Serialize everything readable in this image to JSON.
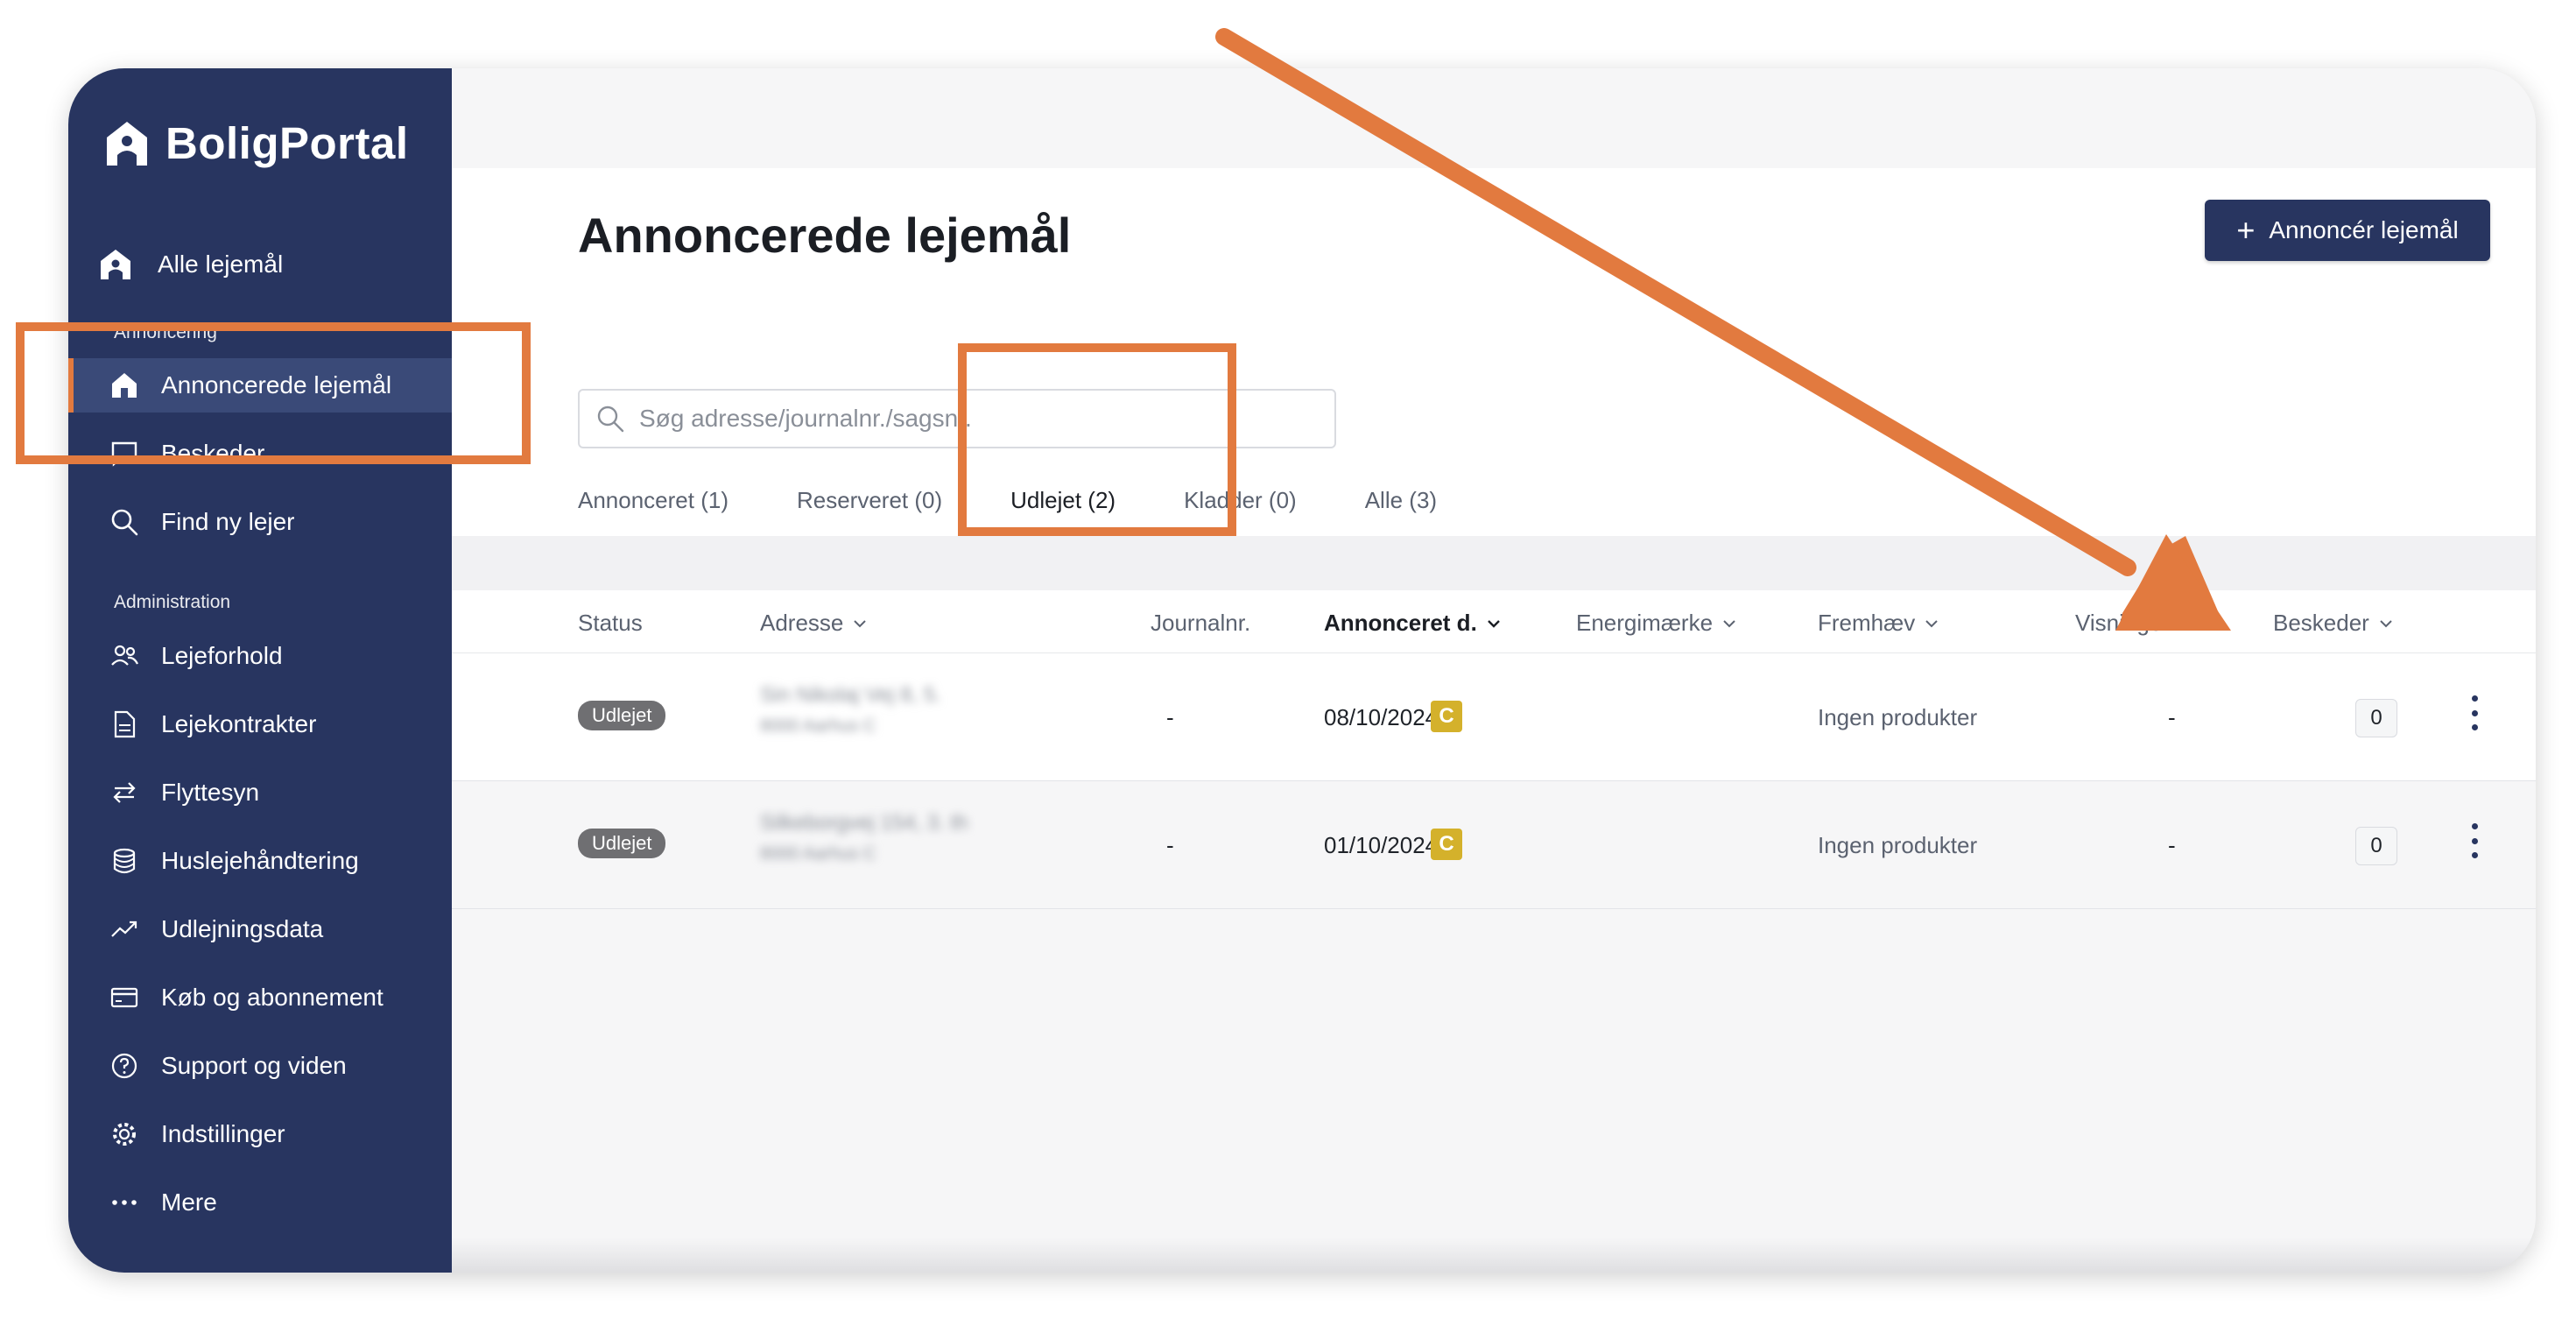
{
  "brand": {
    "name": "BoligPortal"
  },
  "colors": {
    "sidebar": "#283560",
    "accent": "#e27a3f",
    "energy_c": "#d4b12b",
    "status_rented": "#6f6f72"
  },
  "sidebar": {
    "top_item": {
      "label": "Alle lejemål",
      "icon": "house-person-icon"
    },
    "section_annoncering": "Annoncering",
    "annoncering_items": [
      {
        "label": "Annoncerede lejemål",
        "icon": "home-icon",
        "active": true
      },
      {
        "label": "Beskeder",
        "icon": "chat-icon"
      },
      {
        "label": "Find ny lejer",
        "icon": "search-icon"
      }
    ],
    "section_administration": "Administration",
    "administration_items": [
      {
        "label": "Lejeforhold",
        "icon": "people-icon"
      },
      {
        "label": "Lejekontrakter",
        "icon": "document-icon"
      },
      {
        "label": "Flyttesyn",
        "icon": "arrows-swap-icon"
      },
      {
        "label": "Huslejehåndtering",
        "icon": "database-icon"
      },
      {
        "label": "Udlejningsdata",
        "icon": "trend-icon"
      },
      {
        "label": "Køb og abonnement",
        "icon": "credit-card-icon"
      },
      {
        "label": "Support og viden",
        "icon": "help-icon"
      },
      {
        "label": "Indstillinger",
        "icon": "gear-icon"
      },
      {
        "label": "Mere",
        "icon": "more-icon"
      }
    ]
  },
  "header": {
    "title": "Annoncerede lejemål",
    "cta_label": "Annoncér lejemål",
    "search_placeholder": "Søg adresse/journalnr./sagsnr."
  },
  "tabs": [
    {
      "label": "Annonceret (1)"
    },
    {
      "label": "Reserveret (0)"
    },
    {
      "label": "Udlejet (2)",
      "active": true
    },
    {
      "label": "Kladder (0)"
    },
    {
      "label": "Alle (3)"
    }
  ],
  "table": {
    "columns": [
      "Status",
      "Adresse",
      "Journalnr.",
      "Annonceret d.",
      "Energimærke",
      "Fremhæv",
      "Visninger",
      "Beskeder"
    ],
    "rows": [
      {
        "status": "Udlejet",
        "address_line1": "Sin Nikolaj Vej 8, 5.",
        "address_line2": "8000 Aarhus C",
        "journal": "-",
        "date": "08/10/2024",
        "energy": "C",
        "highlight": "Ingen produkter",
        "views": "-",
        "messages": "0"
      },
      {
        "status": "Udlejet",
        "address_line1": "Silkeborgvej 154, 3. th",
        "address_line2": "8000 Aarhus C",
        "journal": "-",
        "date": "01/10/2024",
        "energy": "C",
        "highlight": "Ingen produkter",
        "views": "-",
        "messages": "0"
      }
    ]
  }
}
